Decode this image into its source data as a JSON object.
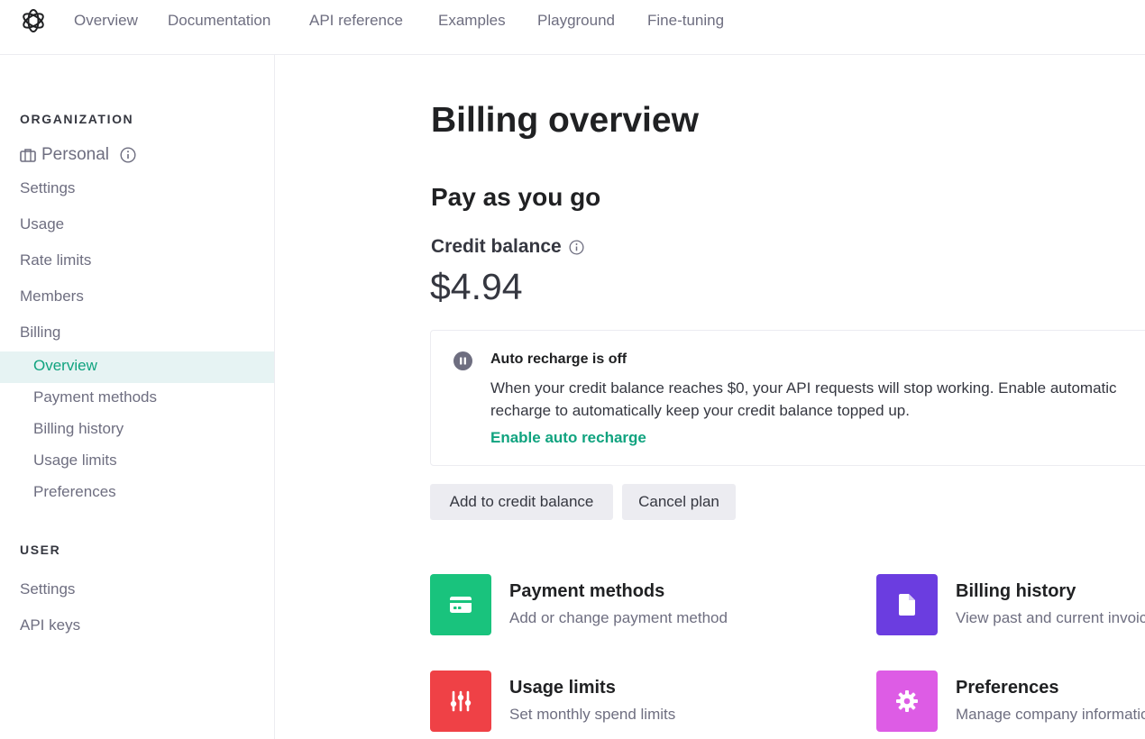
{
  "topnav": {
    "logo": "openai-logo",
    "items": [
      "Overview",
      "Documentation",
      "API reference",
      "Examples",
      "Playground",
      "Fine-tuning"
    ]
  },
  "sidebar": {
    "organization_title": "ORGANIZATION",
    "org_name": "Personal",
    "org_items": [
      "Settings",
      "Usage",
      "Rate limits",
      "Members",
      "Billing"
    ],
    "billing_subitems": [
      "Overview",
      "Payment methods",
      "Billing history",
      "Usage limits",
      "Preferences"
    ],
    "active_subitem": "Overview",
    "user_title": "USER",
    "user_items": [
      "Settings",
      "API keys"
    ]
  },
  "main": {
    "title": "Billing overview",
    "plan": "Pay as you go",
    "credit_label": "Credit balance",
    "credit_value": "$4.94",
    "notice": {
      "title": "Auto recharge is off",
      "body": "When your credit balance reaches $0, your API requests will stop working. Enable automatic recharge to automatically keep your credit balance topped up.",
      "link": "Enable auto recharge"
    },
    "buttons": {
      "add_credit": "Add to credit balance",
      "cancel": "Cancel plan"
    },
    "cards": [
      {
        "title": "Payment methods",
        "desc": "Add or change payment method",
        "icon": "credit-card-icon",
        "color": "#19c37d"
      },
      {
        "title": "Billing history",
        "desc": "View past and current invoices",
        "icon": "document-icon",
        "color": "#6b3de0"
      },
      {
        "title": "Usage limits",
        "desc": "Set monthly spend limits",
        "icon": "sliders-icon",
        "color": "#ef4146"
      },
      {
        "title": "Preferences",
        "desc": "Manage company information",
        "icon": "gear-icon",
        "color": "#dd5ce5"
      }
    ]
  },
  "colors": {
    "accent": "#10a37f",
    "active_bg": "#e6f3f3",
    "muted_text": "#6e6e80"
  }
}
